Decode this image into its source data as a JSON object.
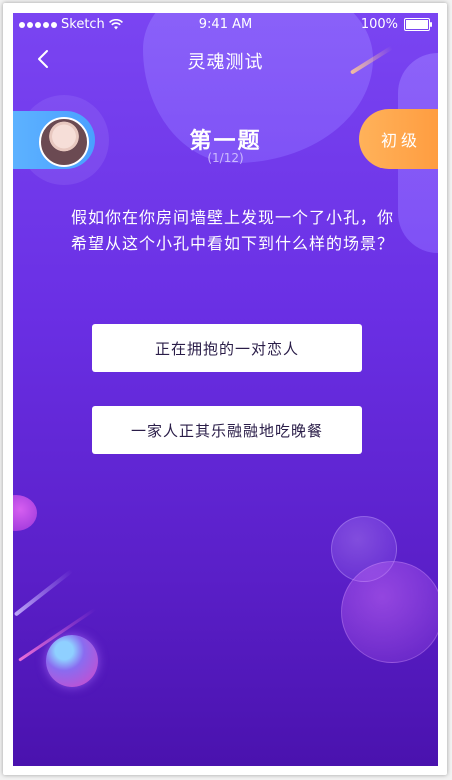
{
  "status_bar": {
    "carrier": "Sketch",
    "time": "9:41 AM",
    "battery": "100%"
  },
  "nav": {
    "title": "灵魂测试",
    "back_icon": "chevron-left-icon"
  },
  "question": {
    "title": "第一题",
    "progress": "(1/12)",
    "level": "初级",
    "text": "假如你在你房间墙壁上发现一个了小孔，你希望从这个小孔中看如下到什么样的场景？"
  },
  "options": [
    {
      "label": "正在拥抱的一对恋人"
    },
    {
      "label": "一家人正其乐融融地吃晚餐"
    }
  ],
  "colors": {
    "background_top": "#7a45f2",
    "background_bottom": "#4a12ae",
    "avatar_pill": "#4aa0ff",
    "level_badge": "#ff9a3d",
    "option_text": "#2a1d48"
  }
}
